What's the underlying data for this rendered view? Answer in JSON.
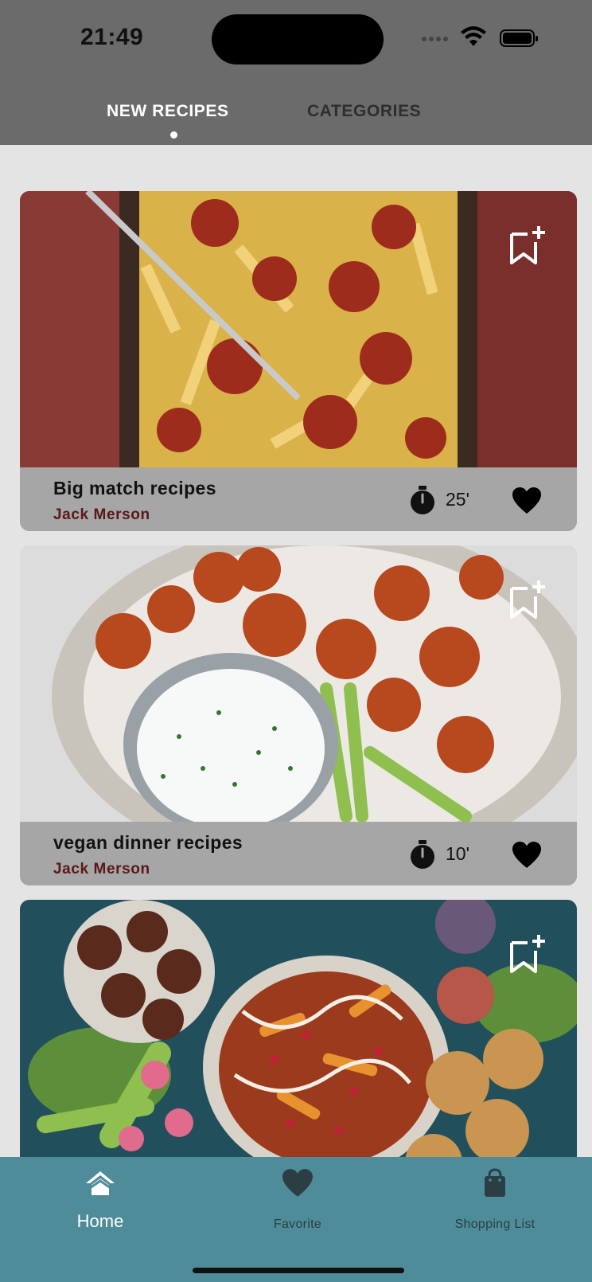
{
  "status_bar": {
    "time": "21:49"
  },
  "tabs": [
    {
      "label": "NEW RECIPES",
      "active": true
    },
    {
      "label": "CATEGORIES",
      "active": false
    }
  ],
  "recipes": [
    {
      "title": "Big match recipes",
      "author": "Jack Merson",
      "duration": "25'",
      "image": "loaded-fries-meatballs",
      "liked": true
    },
    {
      "title": "vegan dinner recipes",
      "author": "Jack Merson",
      "duration": "10'",
      "image": "cauliflower-wings-dip",
      "liked": true
    },
    {
      "title": "",
      "author": "",
      "duration": "",
      "image": "mezze-platter",
      "liked": false
    }
  ],
  "bottom_nav": [
    {
      "label": "Home",
      "icon": "home-icon",
      "active": true
    },
    {
      "label": "Favorite",
      "icon": "heart-icon",
      "active": false
    },
    {
      "label": "Shopping List",
      "icon": "shopping-bag-icon",
      "active": false
    }
  ],
  "colors": {
    "header": "#6b6b6b",
    "nav": "#4f8c99",
    "author": "#5a1818",
    "background": "#e4e4e4"
  }
}
